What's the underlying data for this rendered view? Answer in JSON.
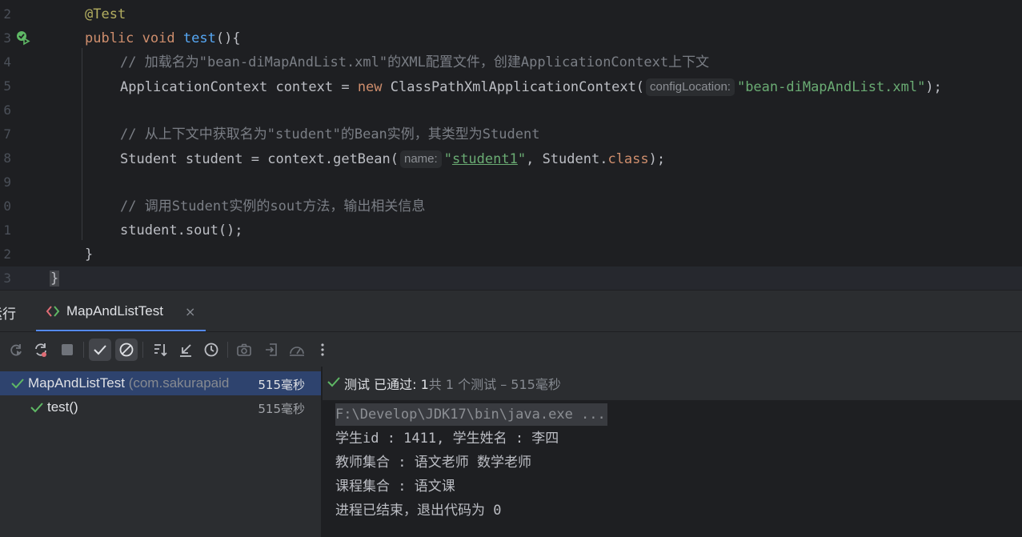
{
  "editor": {
    "line_numbers": [
      "2",
      "3",
      "4",
      "5",
      "6",
      "7",
      "8",
      "9",
      "0",
      "1",
      "2",
      "3"
    ],
    "annotation": "@Test",
    "method": {
      "kw_public": "public",
      "kw_void": "void",
      "name": "test",
      "rest": "(){"
    },
    "comment1": {
      "prefix": "// ",
      "text_a": "加载名为",
      "q1": "\"bean-diMapAndList.xml\"",
      "text_b": "的",
      "xml": "XML",
      "text_c": "配置文件，创建",
      "ac": "ApplicationContext",
      "text_d": "上下文"
    },
    "line_context": {
      "decl": "ApplicationContext context = ",
      "kw_new": "new",
      "ctor": " ClassPathXmlApplicationContext(",
      "hint": "configLocation:",
      "arg": "\"bean-diMapAndList.xml\"",
      "end": ");"
    },
    "comment2": {
      "prefix": "// ",
      "text_a": "从上下文中获取名为",
      "q": "\"student\"",
      "text_b": "的",
      "bean": "Bean",
      "text_c": "实例，其类型为",
      "student": "Student"
    },
    "line_student": {
      "decl": "Student student = context.getBean(",
      "hint": "name:",
      "q_open": "\"",
      "arg": "student1",
      "q_close": "\"",
      "mid": ", Student.",
      "kw_class": "class",
      "end": ");"
    },
    "comment3": {
      "prefix": "// ",
      "text_a": "调用",
      "student": "Student",
      "text_b": "实例的",
      "sout": "sout",
      "text_c": "方法，输出相关信息"
    },
    "line_sout": "student.sout();",
    "close_method": "}",
    "close_class": "}"
  },
  "tool_window": {
    "title": "运行",
    "tab_label": "MapAndListTest",
    "tab_close": "×"
  },
  "test_tree": {
    "root": {
      "name": "MapAndListTest",
      "package": "(com.sakurapaid",
      "time": "515毫秒"
    },
    "child": {
      "name": "test()",
      "time": "515毫秒"
    }
  },
  "console": {
    "status_label": "测试 已通过: 1",
    "status_detail": "共 1 个测试 – 515毫秒",
    "lines": [
      "F:\\Develop\\JDK17\\bin\\java.exe ...",
      "学生id : 1411, 学生姓名 : 李四",
      "教师集合 : 语文老师 数学老师",
      "课程集合 : 语文课",
      "进程已结束，退出代码为 0"
    ]
  },
  "colors": {
    "accent": "#548af7",
    "pass_green": "#5fb865",
    "editor_bg": "#1e1f22",
    "panel_bg": "#2b2d30"
  },
  "icons": [
    "run-test-gutter-icon",
    "test-class-icon",
    "rerun-icon",
    "rerun-failed-icon",
    "stop-icon",
    "show-passed-icon",
    "show-ignored-icon",
    "sort-alpha-icon",
    "sort-collapse-icon",
    "sort-duration-icon",
    "camera-icon",
    "import-tests-icon",
    "coverage-icon",
    "more-options-icon",
    "check-icon"
  ]
}
